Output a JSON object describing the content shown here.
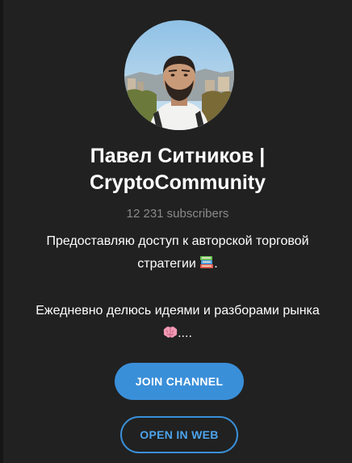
{
  "channel": {
    "title_line1": "Павел Ситников |",
    "title_line2": "CryptoCommunity",
    "subscribers": "12 231 subscribers",
    "description_line1": "Предоставляю доступ к авторской торговой",
    "description_line2": "стратегии",
    "description_emoji1": "books-emoji",
    "description_line3": "Ежедневно делюсь идеями и разборами рынка",
    "description_emoji2": "brain-emoji",
    "description_suffix": "...."
  },
  "buttons": {
    "join_label": "JOIN CHANNEL",
    "open_web_label": "OPEN IN WEB"
  },
  "colors": {
    "background": "#212121",
    "accent": "#3a8fd9",
    "muted_text": "#8a8a8a"
  }
}
